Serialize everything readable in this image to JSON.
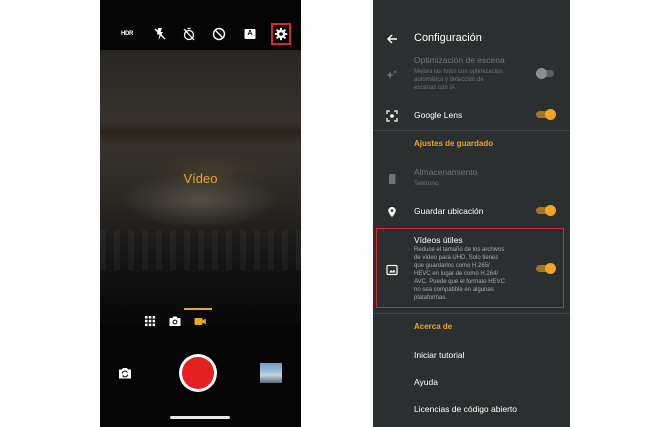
{
  "camera": {
    "toolbar_icons": [
      "hdr-icon",
      "flash-off-icon",
      "timer-off-icon",
      "night-off-icon",
      "auto-mode-icon",
      "gear-icon"
    ],
    "hdr_label": "HDR",
    "auto_label": "A",
    "mode_label": "Vídeo",
    "modes": [
      "more-modes-icon",
      "photo-camera-icon",
      "video-camera-icon"
    ],
    "active_mode": "video",
    "accent": "#e9a62a",
    "shutter_color": "#e3201f"
  },
  "settings": {
    "title": "Configuración",
    "scene_optimization": {
      "title": "Optimización de escena",
      "subtitle_lines": [
        "Mejora las fotos con optimización",
        "automática y detección de",
        "escenas con IA"
      ],
      "enabled": false
    },
    "google_lens": {
      "title": "Google Lens",
      "enabled": true
    },
    "save_section": "Ajustes de guardado",
    "storage": {
      "title": "Almacenamiento",
      "value": "Teléfono"
    },
    "save_location": {
      "title": "Guardar ubicación",
      "enabled": true
    },
    "useful_videos": {
      "title": "Vídeos útiles",
      "subtitle_lines": [
        "Reduce el tamaño de los archivos",
        "de vídeo para UHD. Solo tienes",
        "que guardarlos como H.265/",
        "HEVC en lugar de como H.264/",
        "AVC. Puede que el formato HEVC",
        "no sea compatible en algunas",
        "plataformas."
      ],
      "enabled": true
    },
    "about_section": "Acerca de",
    "about_items": [
      "Iniciar tutorial",
      "Ayuda",
      "Licencias de código abierto"
    ],
    "accent": "#e9a62a"
  }
}
